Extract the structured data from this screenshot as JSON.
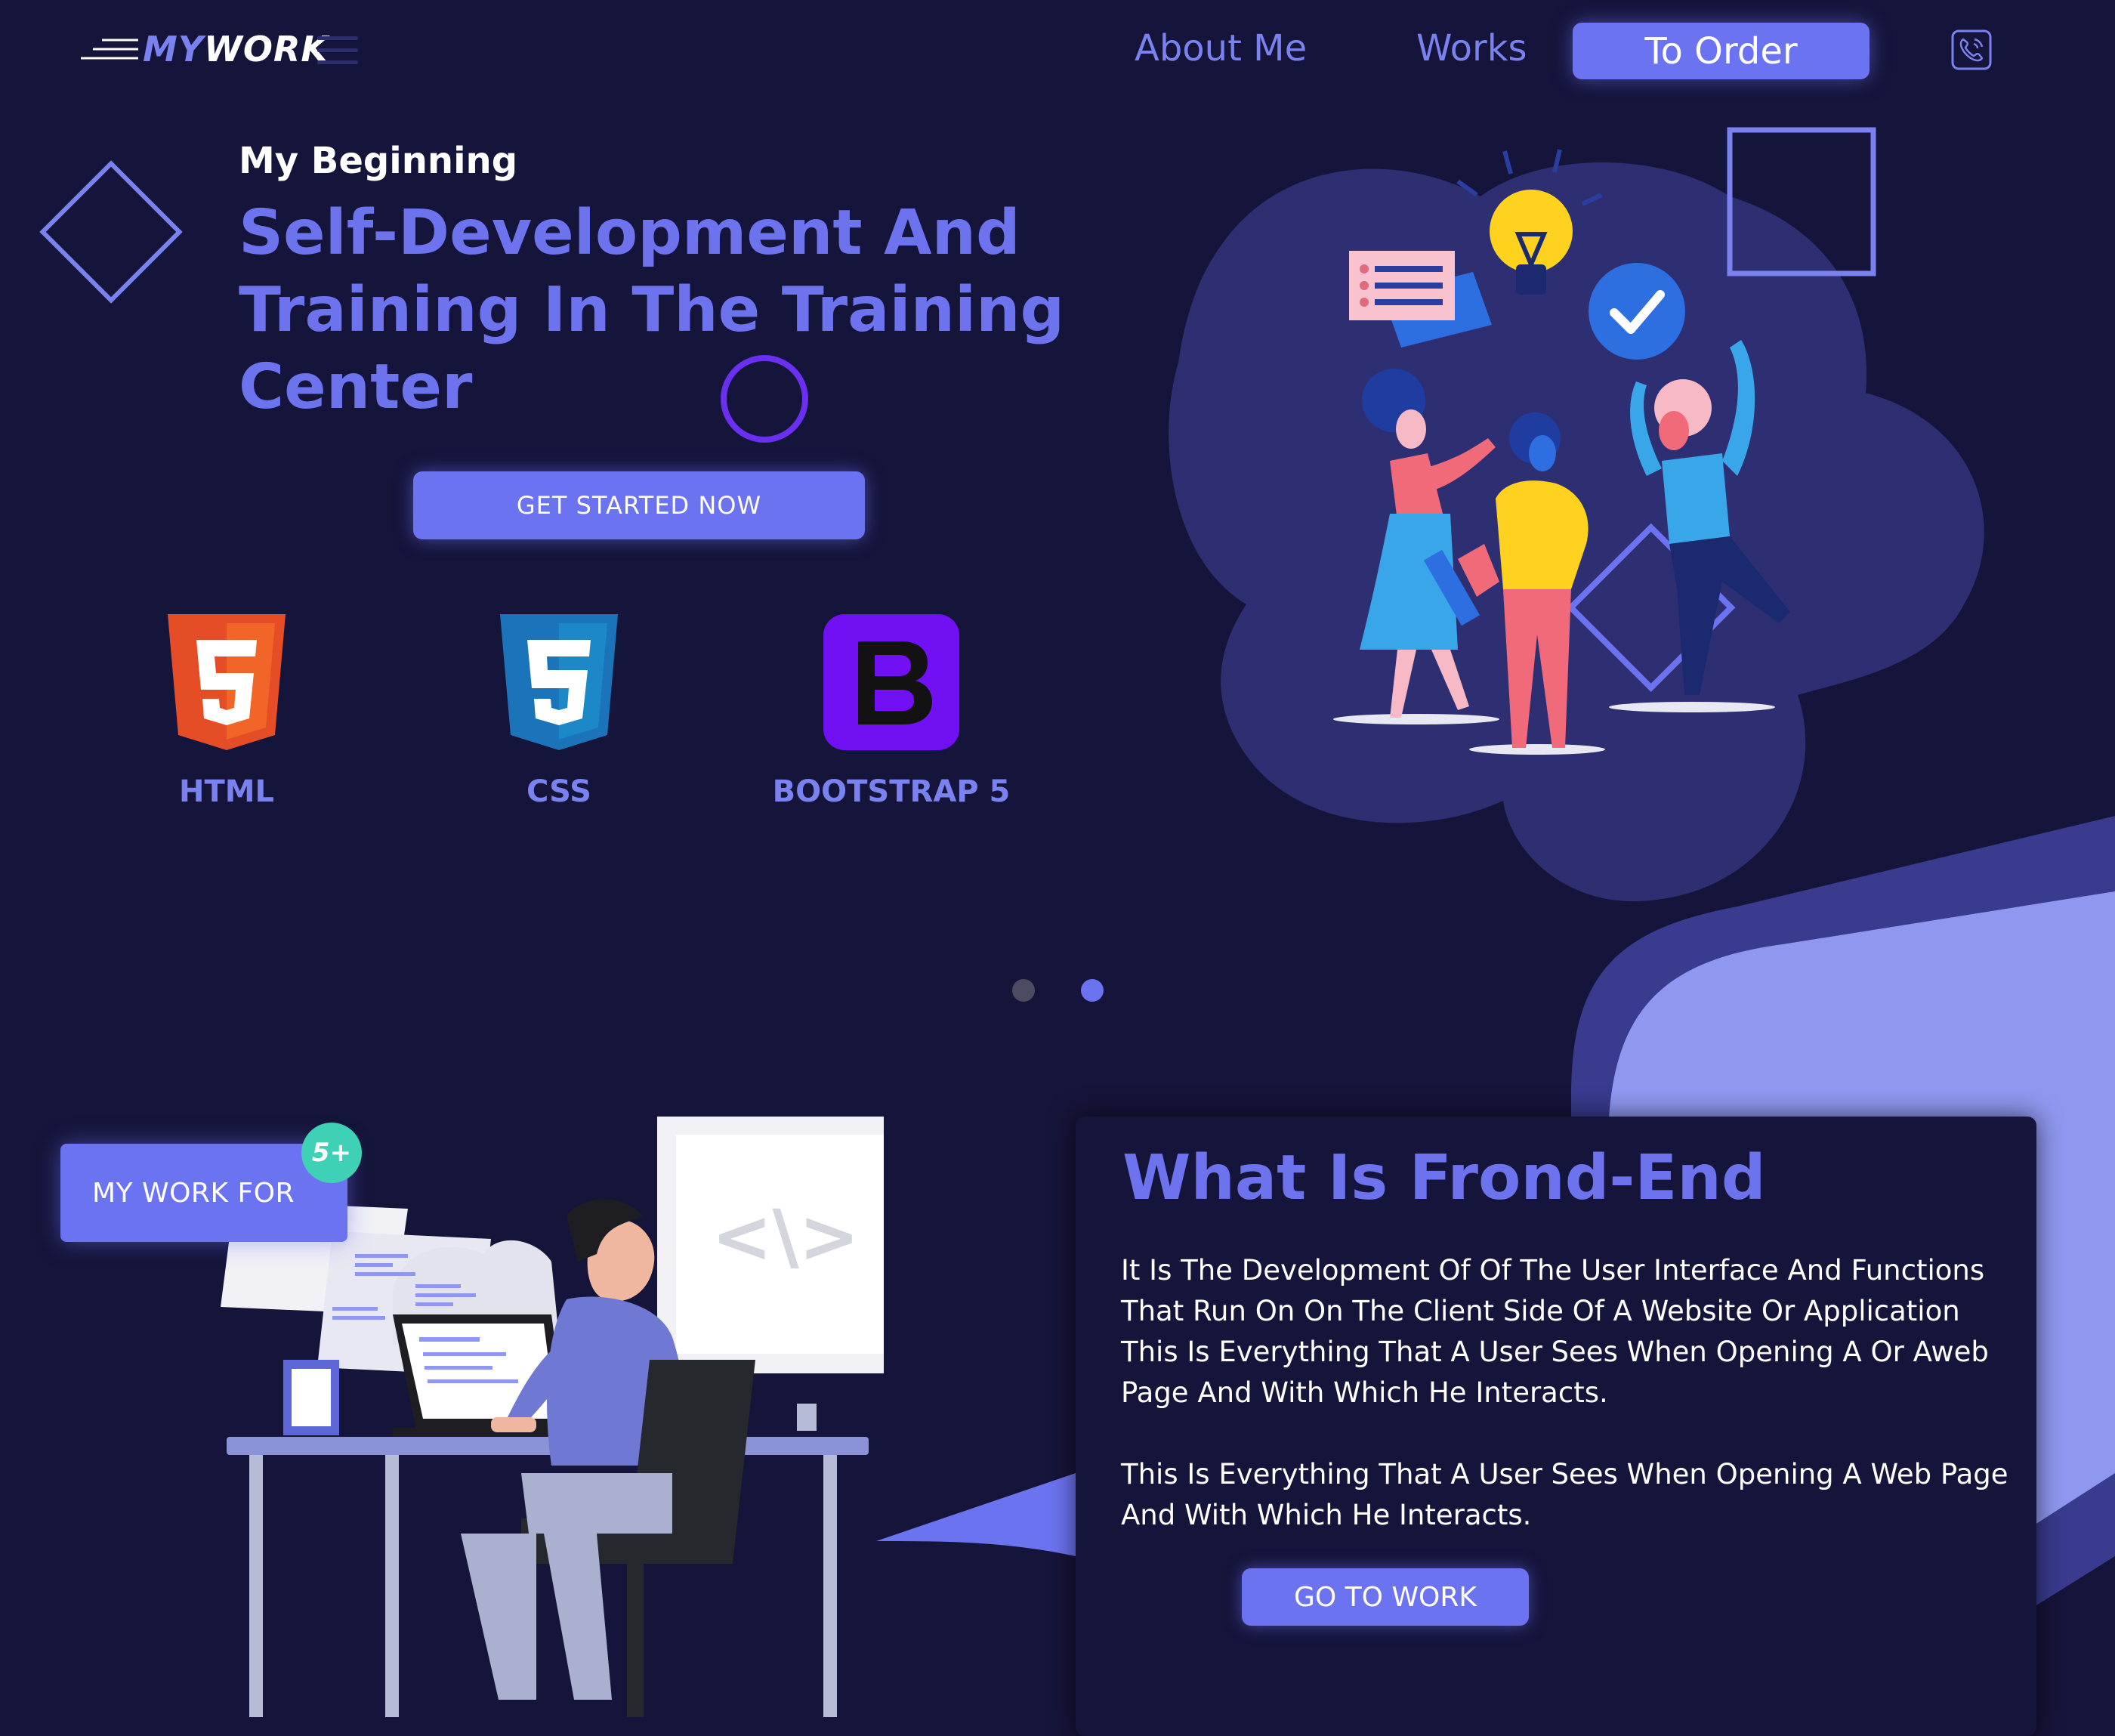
{
  "header": {
    "logo": {
      "part1": "MY",
      "part2": "WORK"
    },
    "nav": [
      {
        "label": "About Me"
      },
      {
        "label": "Works"
      },
      {
        "label": "To Order"
      }
    ],
    "icons": {
      "menu": "menu-icon",
      "phone": "phone-icon"
    }
  },
  "hero": {
    "kicker": "My Beginning",
    "title_lines": [
      "Self-Development And",
      "Training In The Training",
      "Center"
    ],
    "cta": "GET STARTED NOW",
    "technologies": [
      {
        "label": "HTML",
        "icon": "html5-icon"
      },
      {
        "label": "CSS",
        "icon": "css3-icon"
      },
      {
        "label": "BOOTSTRAP 5",
        "icon": "bootstrap-icon"
      }
    ],
    "illustration": "team-ideas-illustration"
  },
  "slider": {
    "count": 2,
    "active": 2
  },
  "work": {
    "badge_label": "MY WORK FOR",
    "badge_count": "5+",
    "illustration": "developer-at-desk-illustration"
  },
  "frontend_card": {
    "title": "What Is Frond-End",
    "paragraphs": [
      "It Is The Development Of Of The User Interface And Functions That Run On On The Client Side Of A Website Or Application This Is Everything That A User Sees When Opening A Or Aweb Page And With Which He Interacts.",
      "This Is Everything That A User Sees When Opening A Web Page And With Which He Interacts."
    ],
    "button": "GO TO WORK"
  },
  "colors": {
    "background": "#15143a",
    "accent": "#6c73f0",
    "accent_light": "#8f97f0",
    "badge_teal": "#3fd1b6",
    "blob": "#2e2f73"
  }
}
